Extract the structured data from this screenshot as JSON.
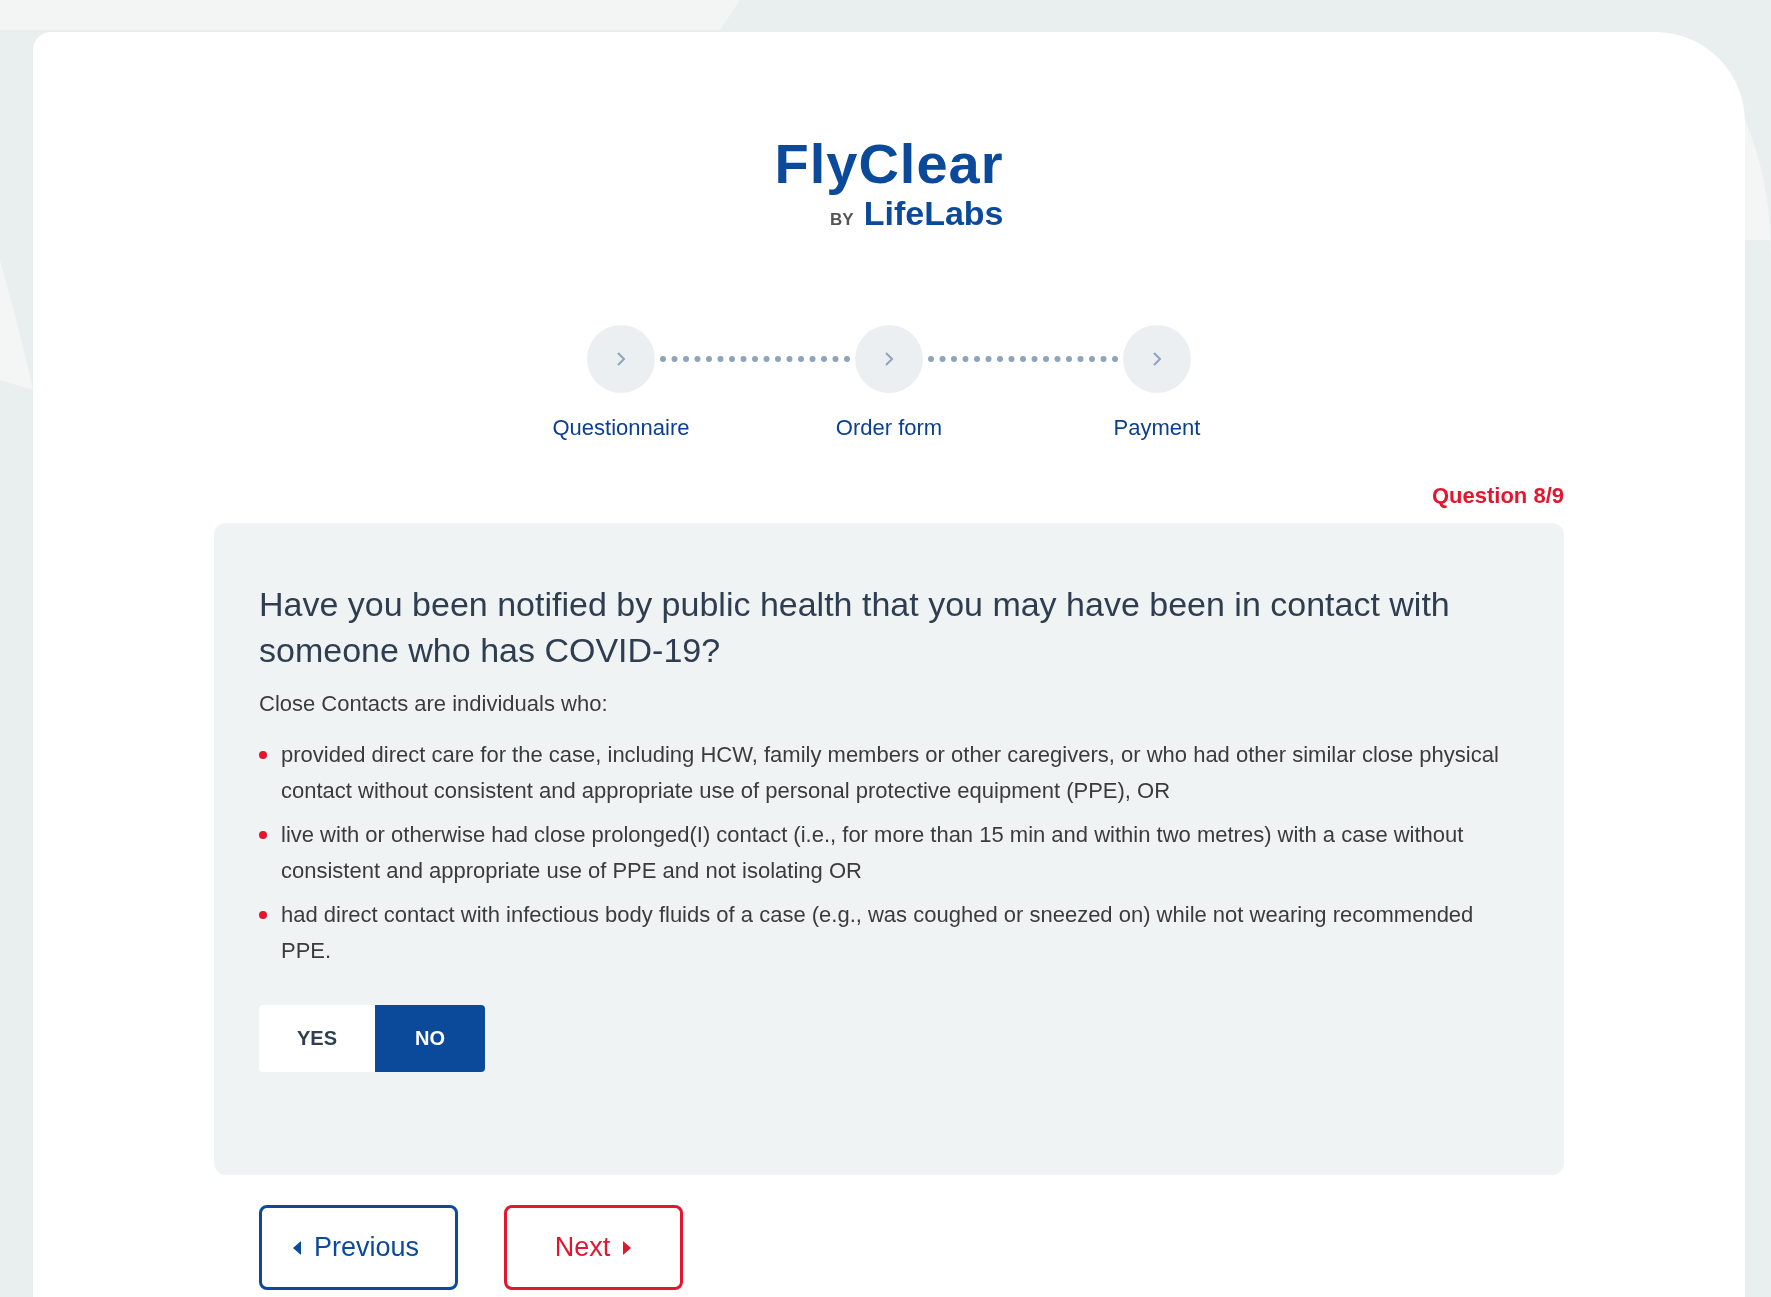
{
  "logo": {
    "brand": "FlyClear",
    "by": "BY",
    "maker": "LifeLabs"
  },
  "steps": [
    {
      "label": "Questionnaire"
    },
    {
      "label": "Order form"
    },
    {
      "label": "Payment"
    }
  ],
  "counter": "Question 8/9",
  "question": {
    "title": "Have you been notified by public health that you may have been in contact with someone who has COVID-19?",
    "intro": "Close Contacts are individuals who:",
    "bullets": [
      "provided direct care for the case, including HCW, family members or other caregivers, or who had other similar close physical contact without consistent and appropriate use of personal protective equipment (PPE), OR",
      "live with or otherwise had close prolonged(I) contact (i.e., for more than 15 min and within two metres) with a case without consistent and appropriate use of PPE and not isolating OR",
      "had direct contact with infectious body fluids of a case (e.g., was coughed or sneezed on) while not wearing recommended PPE."
    ],
    "options": [
      {
        "label": "YES",
        "selected": false
      },
      {
        "label": "NO",
        "selected": true
      }
    ]
  },
  "nav": {
    "previous": "Previous",
    "next": "Next"
  }
}
